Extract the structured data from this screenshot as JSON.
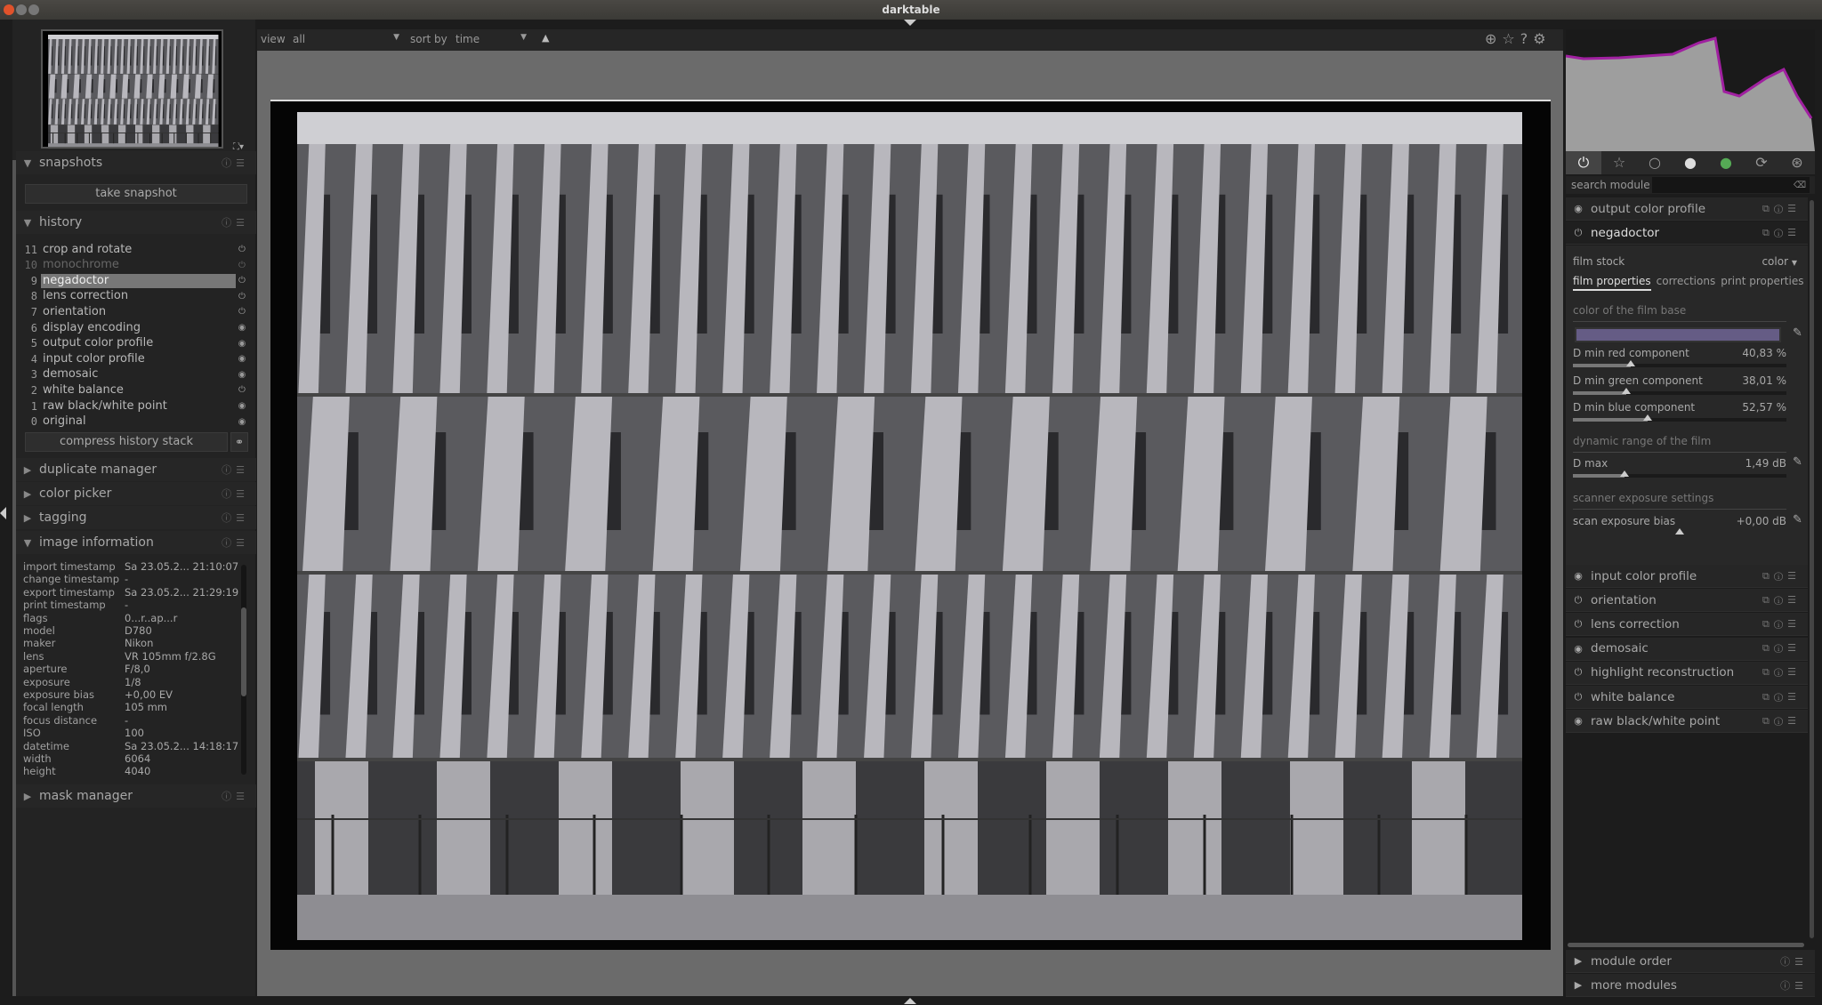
{
  "app": {
    "title": "darktable"
  },
  "colors": {
    "film_base": "#655c85",
    "panel": "#232323",
    "center": "#6b6b6b"
  },
  "left": {
    "snapshots": {
      "title": "snapshots",
      "take_snapshot": "take snapshot"
    },
    "history": {
      "title": "history",
      "items": [
        {
          "n": "11",
          "label": "crop and rotate",
          "icon": "power-icon",
          "enabled": true
        },
        {
          "n": "10",
          "label": "monochrome",
          "icon": "power-icon",
          "enabled": false
        },
        {
          "n": "9",
          "label": "negadoctor",
          "icon": "power-icon",
          "enabled": true,
          "selected": true
        },
        {
          "n": "8",
          "label": "lens correction",
          "icon": "power-icon",
          "enabled": true
        },
        {
          "n": "7",
          "label": "orientation",
          "icon": "power-icon",
          "enabled": true
        },
        {
          "n": "6",
          "label": "display encoding",
          "icon": "always-on-icon",
          "enabled": true
        },
        {
          "n": "5",
          "label": "output color profile",
          "icon": "always-on-icon",
          "enabled": true
        },
        {
          "n": "4",
          "label": "input color profile",
          "icon": "always-on-icon",
          "enabled": true
        },
        {
          "n": "3",
          "label": "demosaic",
          "icon": "always-on-icon",
          "enabled": true
        },
        {
          "n": "2",
          "label": "white balance",
          "icon": "power-icon",
          "enabled": true
        },
        {
          "n": "1",
          "label": "raw black/white point",
          "icon": "always-on-icon",
          "enabled": true
        },
        {
          "n": "0",
          "label": "original",
          "icon": "always-on-icon",
          "enabled": true
        }
      ],
      "compress": "compress history stack"
    },
    "collapsed": [
      "duplicate manager",
      "color picker",
      "tagging"
    ],
    "image_information": {
      "title": "image information",
      "rows": [
        [
          "import timestamp",
          "Sa 23.05.2... 21:10:07"
        ],
        [
          "change timestamp",
          "-"
        ],
        [
          "export timestamp",
          "Sa 23.05.2... 21:29:19"
        ],
        [
          "print timestamp",
          "-"
        ],
        [
          "flags",
          "0...r..ap...r"
        ],
        [
          "model",
          "D780"
        ],
        [
          "maker",
          "Nikon"
        ],
        [
          "lens",
          "VR 105mm f/2.8G"
        ],
        [
          "aperture",
          "F/8,0"
        ],
        [
          "exposure",
          "1/8"
        ],
        [
          "exposure bias",
          "+0,00 EV"
        ],
        [
          "focal length",
          "105 mm"
        ],
        [
          "focus distance",
          "-"
        ],
        [
          "ISO",
          "100"
        ],
        [
          "datetime",
          "Sa 23.05.2... 14:18:17"
        ],
        [
          "width",
          "6064"
        ],
        [
          "height",
          "4040"
        ]
      ]
    },
    "mask_manager": "mask manager"
  },
  "toolbar": {
    "view_label": "view",
    "view_value": "all",
    "sort_label": "sort by",
    "sort_value": "time",
    "sort_dir": "ascending"
  },
  "right": {
    "search_label": "search module",
    "search_value": "",
    "tabs": [
      "power-icon",
      "star-icon",
      "circle-icon",
      "gradient-icon",
      "color-wheel-icon",
      "refresh-icon",
      "aperture-icon"
    ],
    "top_modules": [
      {
        "label": "output color profile",
        "icon": "always-on-icon"
      },
      {
        "label": "negadoctor",
        "icon": "power-icon"
      }
    ],
    "negadoctor": {
      "film_stock_label": "film stock",
      "film_stock_value": "color",
      "tabs": [
        "film properties",
        "corrections",
        "print properties"
      ],
      "active_tab": "film properties",
      "section1": "color of the film base",
      "sliders1": [
        {
          "label": "D min red component",
          "value": "40,83 %",
          "pos": 0.27
        },
        {
          "label": "D min green component",
          "value": "38,01 %",
          "pos": 0.25
        },
        {
          "label": "D min blue component",
          "value": "52,57 %",
          "pos": 0.35
        }
      ],
      "section2": "dynamic range of the film",
      "dmax": {
        "label": "D max",
        "value": "1,49 dB",
        "pos": 0.24
      },
      "section3": "scanner exposure settings",
      "scan": {
        "label": "scan exposure bias",
        "value": "+0,00 dB",
        "pos": 0.5
      }
    },
    "modules": [
      {
        "label": "input color profile",
        "icon": "always-on-icon"
      },
      {
        "label": "orientation",
        "icon": "power-icon"
      },
      {
        "label": "lens correction",
        "icon": "power-icon"
      },
      {
        "label": "demosaic",
        "icon": "always-on-icon"
      },
      {
        "label": "highlight reconstruction",
        "icon": "power-icon"
      },
      {
        "label": "white balance",
        "icon": "power-icon"
      },
      {
        "label": "raw black/white point",
        "icon": "always-on-icon"
      }
    ],
    "bottom": [
      "module order",
      "more modules"
    ]
  }
}
